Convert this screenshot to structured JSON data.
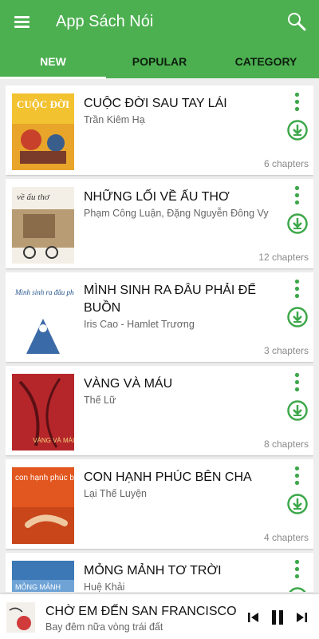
{
  "app": {
    "title": "App Sách Nói"
  },
  "tabs": [
    {
      "label": "NEW",
      "active": true
    },
    {
      "label": "POPULAR",
      "active": false
    },
    {
      "label": "CATEGORY",
      "active": false
    }
  ],
  "colors": {
    "primary": "#4caf50",
    "accent_icon": "#3da84a"
  },
  "books": [
    {
      "title": "CUỘC ĐỜI SAU TAY LÁI",
      "author": "Trần Kiêm Hạ",
      "chapters": "6 chapters"
    },
    {
      "title": "NHỮNG LỐI VỀ ẤU THƠ",
      "author": "Phạm Công Luận, Đặng Nguyễn Đông Vy",
      "chapters": "12 chapters"
    },
    {
      "title": "MÌNH SINH RA ĐÂU PHẢI ĐỂ BUỒN",
      "author": "Iris Cao - Hamlet Trương",
      "chapters": "3 chapters"
    },
    {
      "title": "VÀNG VÀ MÁU",
      "author": "Thế Lữ",
      "chapters": "8 chapters"
    },
    {
      "title": "CON HẠNH PHÚC BÊN CHA",
      "author": "Lại Thế Luyện",
      "chapters": "4 chapters"
    },
    {
      "title": "MỎNG MẢNH TƠ TRỜI",
      "author": "Huệ Khải",
      "chapters": ""
    }
  ],
  "covers": [
    {
      "text": "CUỘC ĐỜI"
    },
    {
      "text": "về ấu thơ"
    },
    {
      "text": "Mình sinh ra đâu phải để buồn"
    },
    {
      "text": "VÀNG VÀ MÁU"
    },
    {
      "text": "con hạnh phúc bên cha"
    },
    {
      "text": "MỎNG MẢNH"
    }
  ],
  "player": {
    "title": "CHỜ EM ĐẾN SAN FRANCISCO",
    "subtitle": "Bay đêm nữa vòng trái đất"
  },
  "icons": [
    "menu-icon",
    "search-icon",
    "more-vert-icon",
    "download-icon",
    "skip-previous-icon",
    "pause-icon",
    "skip-next-icon"
  ]
}
